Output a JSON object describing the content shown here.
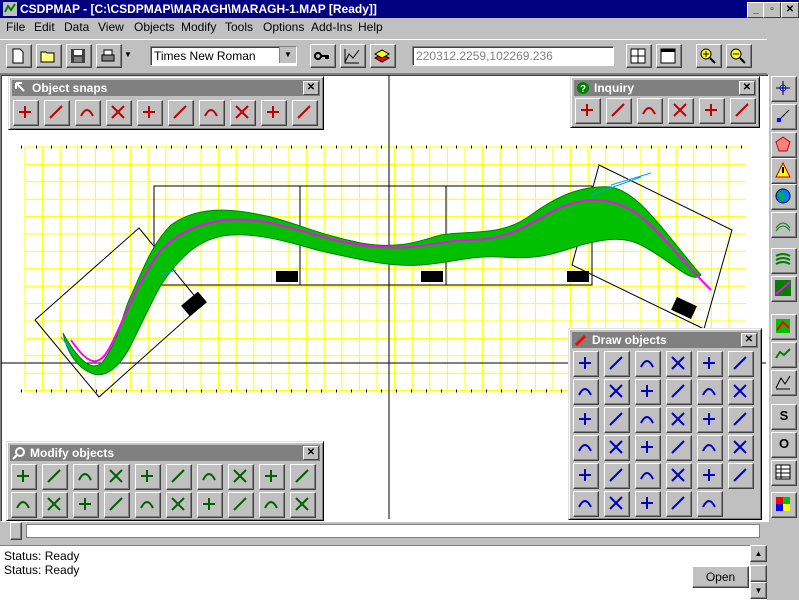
{
  "window": {
    "title": "CSDPMAP - [C:\\CSDPMAP\\MARAGH\\MARAGH-1.MAP [Ready]]",
    "minimize": "_",
    "restore": "▫",
    "close": "✕"
  },
  "menu": [
    {
      "label": "File"
    },
    {
      "label": "Edit"
    },
    {
      "label": "Data"
    },
    {
      "label": "View"
    },
    {
      "label": "Objects"
    },
    {
      "label": "Modify"
    },
    {
      "label": "Tools"
    },
    {
      "label": "Options"
    },
    {
      "label": "Add-Ins"
    },
    {
      "label": "Help"
    }
  ],
  "toolbar": {
    "font_value": "Times New Roman",
    "coordinates": "220312.2259,102269.236"
  },
  "palettes": {
    "object_snaps": {
      "title": "Object snaps",
      "close": "✕"
    },
    "inquiry": {
      "title": "Inquiry",
      "close": "✕"
    },
    "draw_objects": {
      "title": "Draw objects",
      "close": "✕"
    },
    "modify_objects": {
      "title": "Modify objects",
      "close": "✕"
    }
  },
  "status": {
    "line1": "Status: Ready",
    "line2": "Status: Ready",
    "open_button": "Open"
  },
  "right_toolbar_text": {
    "s": "S",
    "o": "O"
  },
  "colors": {
    "titlebar": "#000080",
    "grid": "#ffff00",
    "river": "#00c000",
    "river_center": "#ff00ff",
    "palette_title": "#808080"
  }
}
